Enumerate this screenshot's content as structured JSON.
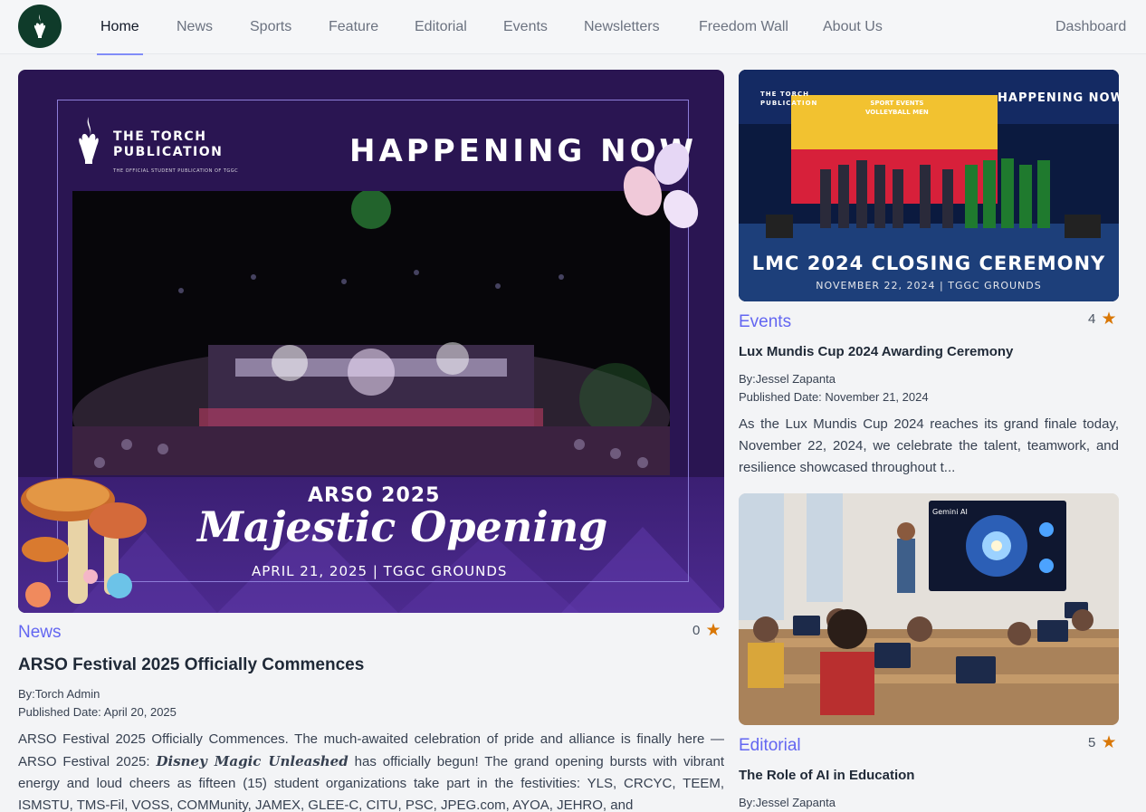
{
  "nav": {
    "logo_alt": "The Torch Publication logo",
    "items": [
      "Home",
      "News",
      "Sports",
      "Feature",
      "Editorial",
      "Events",
      "Newsletters",
      "Freedom Wall",
      "About Us"
    ],
    "active": "Home",
    "dashboard": "Dashboard"
  },
  "featured": {
    "image": {
      "brand_line1": "THE TORCH",
      "brand_line2": "PUBLICATION",
      "brand_tagline": "THE OFFICIAL STUDENT PUBLICATION OF TGGC",
      "headline": "HAPPENING NOW",
      "event": "ARSO 2025",
      "script_title": "Majestic Opening",
      "date_place": "APRIL 21, 2025 | TGGC GROUNDS"
    },
    "category": "News",
    "rating": "0",
    "title": "ARSO Festival 2025 Officially Commences",
    "author": "By:Torch Admin",
    "published": "Published Date: April 20, 2025",
    "excerpt_part1": "ARSO Festival 2025 Officially Commences. The much-awaited celebration of pride and alliance is finally here —ARSO Festival 2025: ",
    "excerpt_em": "Disney Magic Unleashed",
    "excerpt_part2": " has officially begun! The grand opening bursts with vibrant energy and loud cheers as fifteen (15) student organizations take part in the festivities: YLS, CRCYC, TEEM, ISMSTU, TMS-Fil, VOSS, COMMunity, JAMEX, GLEE-C, CITU, PSC, JPEG.com, AYOA, JEHRO, and"
  },
  "side1": {
    "image": {
      "brand_line1": "THE TORCH",
      "brand_line2": "PUBLICATION",
      "headline": "HAPPENING NOW",
      "banner_line1": "SPORT EVENTS",
      "banner_line2": "VOLLEYBALL MEN",
      "caption": "LMC 2024 CLOSING CEREMONY",
      "subcaption": "NOVEMBER 22, 2024 | TGGC GROUNDS"
    },
    "category": "Events",
    "rating": "4",
    "title": "Lux Mundis Cup 2024 Awarding Ceremony",
    "author": "By:Jessel Zapanta",
    "published": "Published Date: November 21, 2024",
    "excerpt": "As the Lux Mundis Cup 2024 reaches its grand finale today, November 22, 2024, we celebrate the talent, teamwork, and resilience showcased throughout t..."
  },
  "side2": {
    "image": {
      "screen_label": "Gemini AI"
    },
    "category": "Editorial",
    "rating": "5",
    "title": "The Role of AI in Education",
    "author": "By:Jessel Zapanta"
  },
  "colors": {
    "accent": "#6366f1",
    "star": "#d97706",
    "logo_bg": "#0f3b2a",
    "hero_bg": "#2a1552"
  }
}
